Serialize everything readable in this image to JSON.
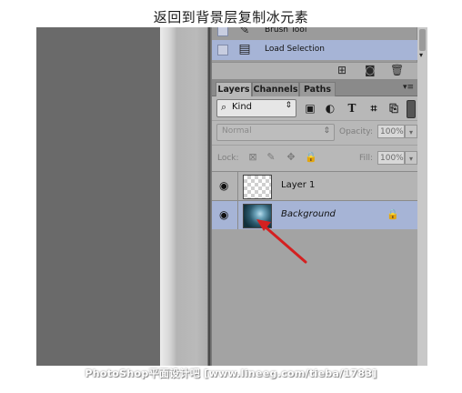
{
  "caption": "返回到背景层复制冰元素",
  "history": {
    "items": [
      {
        "label": "Brush Tool",
        "icon": "brush-icon",
        "selected": false
      },
      {
        "label": "Load Selection",
        "icon": "selection-document-icon",
        "selected": true
      }
    ],
    "footer_icons": [
      "new-snapshot-icon",
      "camera-icon",
      "trash-icon"
    ]
  },
  "layers_panel": {
    "tabs": [
      "Layers",
      "Channels",
      "Paths"
    ],
    "active_tab": "Layers",
    "filter": {
      "kind_label": "Kind",
      "filter_icons": [
        "pixel-filter-icon",
        "adjustment-filter-icon",
        "type-filter-icon",
        "shape-filter-icon",
        "smart-object-filter-icon"
      ]
    },
    "blend_mode": "Normal",
    "opacity_label": "Opacity:",
    "opacity_value": "100%",
    "lock_label": "Lock:",
    "fill_label": "Fill:",
    "fill_value": "100%",
    "layers": [
      {
        "name": "Layer 1",
        "visible": true,
        "selected": false,
        "thumbnail": "transparent"
      },
      {
        "name": "Background",
        "visible": true,
        "selected": true,
        "locked": true,
        "thumbnail": "photo"
      }
    ]
  },
  "colors": {
    "selected_row": "#a6b4d6",
    "annotation_arrow": "#d42020"
  },
  "watermark": "PhotoShop平面设计吧 [www.lineeg.com/tieba/1783]"
}
